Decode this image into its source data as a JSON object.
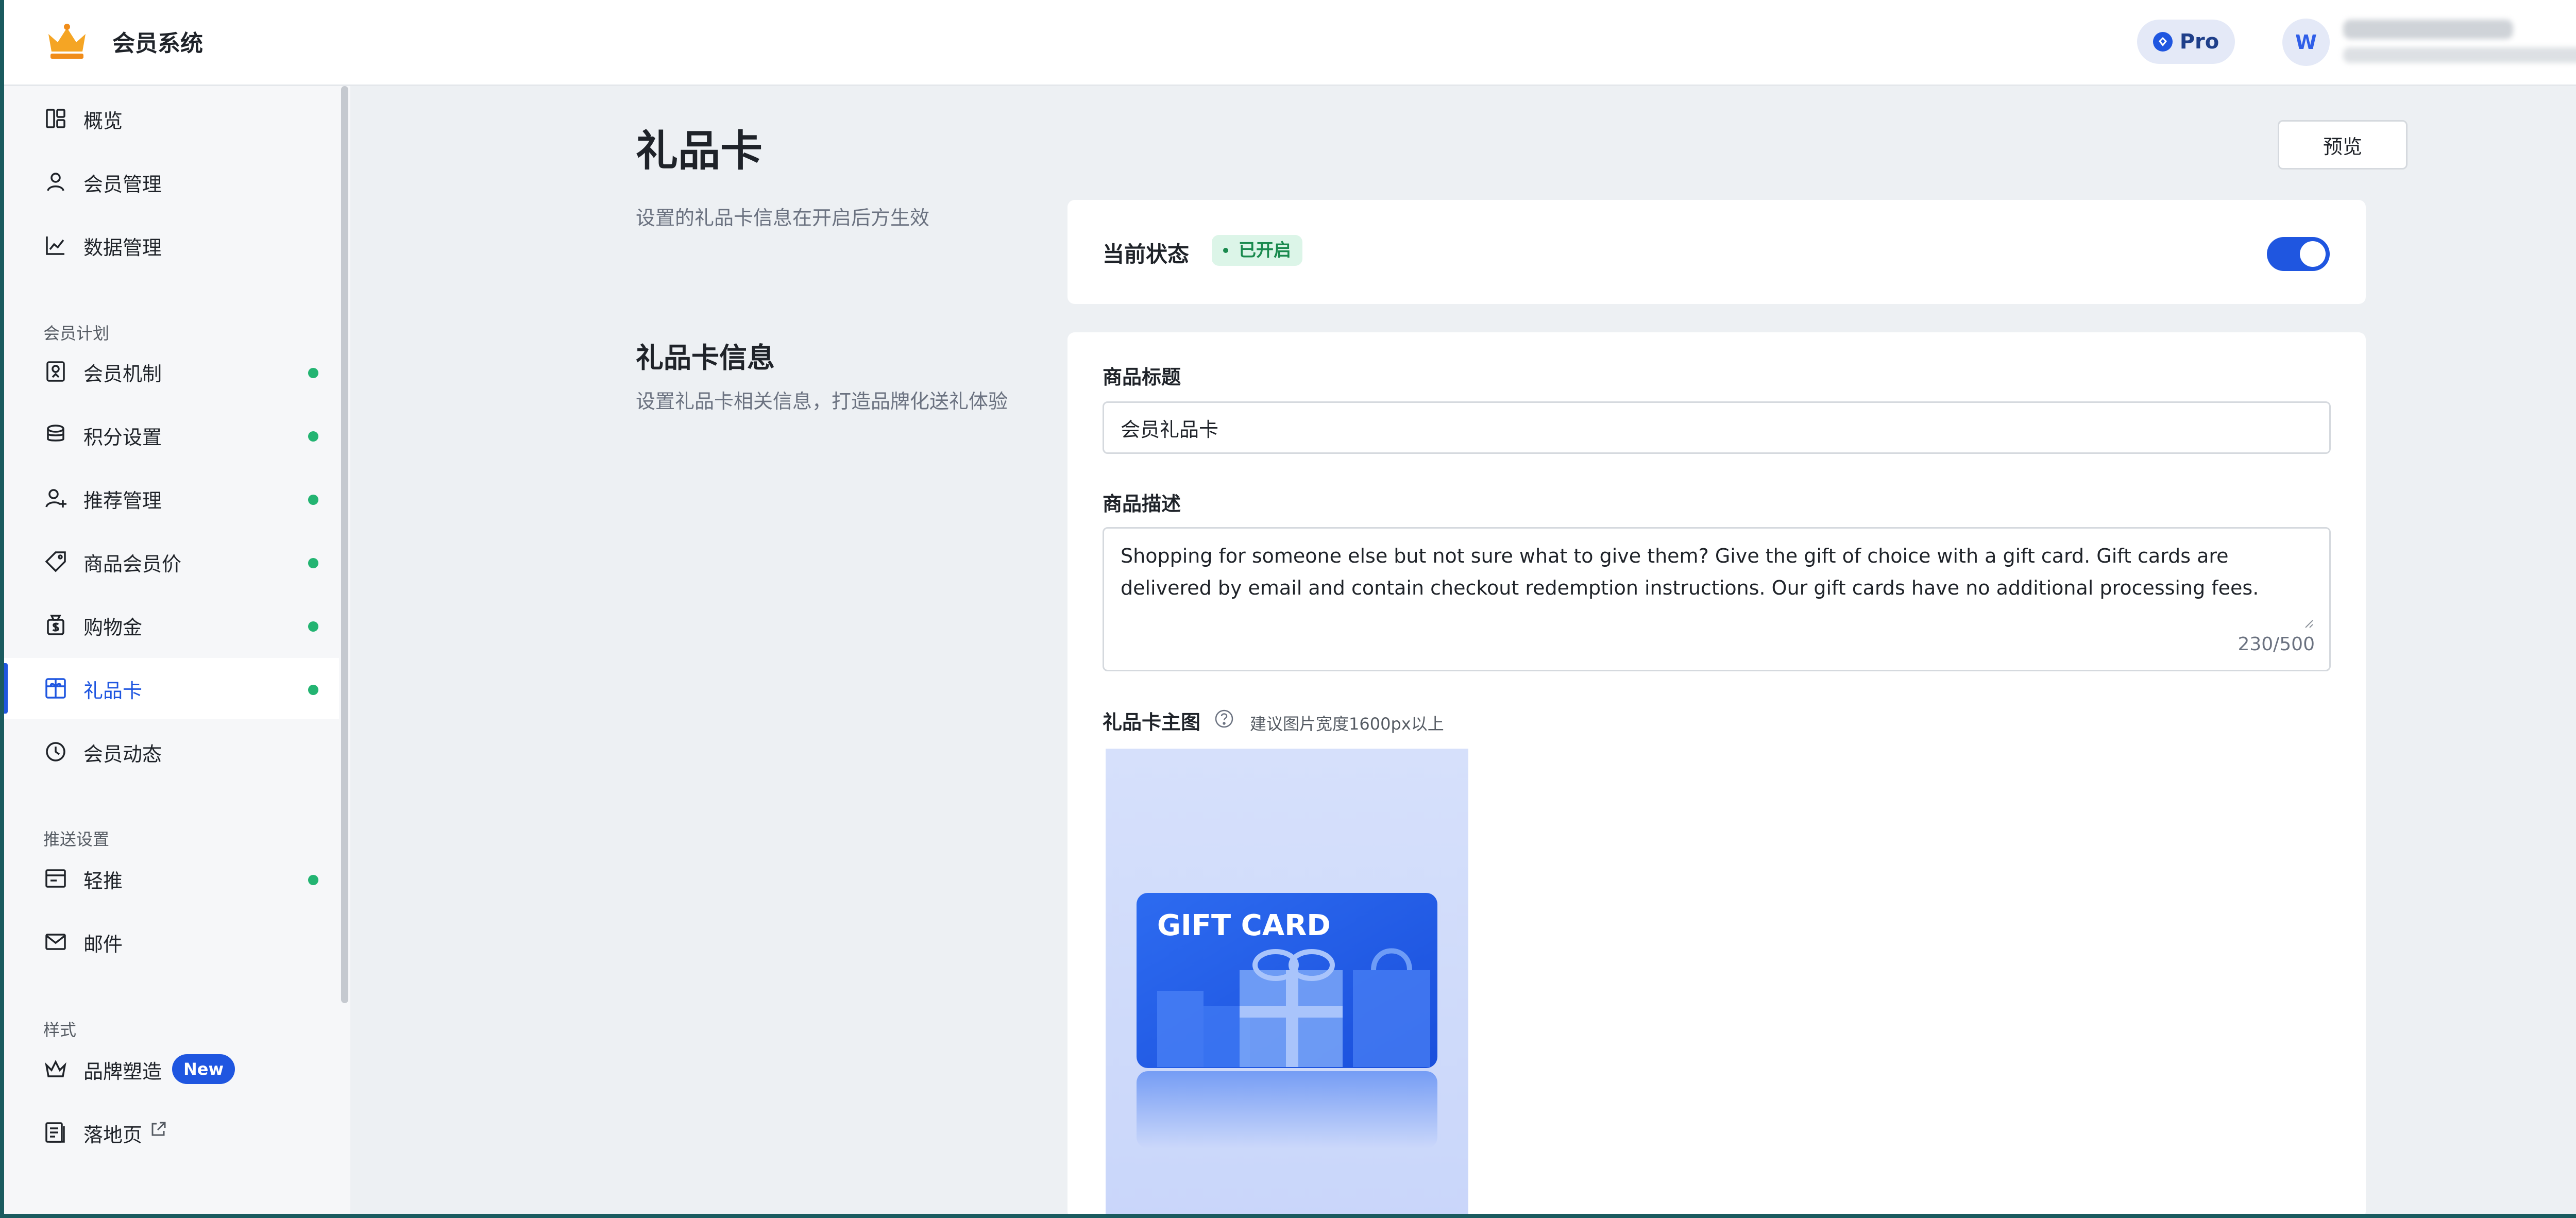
{
  "app": {
    "title": "会员系统",
    "plan": "Pro",
    "avatar_initial": "W"
  },
  "sidebar": {
    "items": [
      {
        "label": "概览",
        "icon": "overview-icon"
      },
      {
        "label": "会员管理",
        "icon": "user-icon"
      },
      {
        "label": "数据管理",
        "icon": "chart-icon"
      },
      {
        "label": "会员机制",
        "icon": "badge-icon",
        "dot": true
      },
      {
        "label": "积分设置",
        "icon": "coins-stack-icon",
        "dot": true
      },
      {
        "label": "推荐管理",
        "icon": "user-add-icon",
        "dot": true
      },
      {
        "label": "商品会员价",
        "icon": "price-tag-icon",
        "dot": true
      },
      {
        "label": "购物金",
        "icon": "money-bag-icon",
        "dot": true
      },
      {
        "label": "礼品卡",
        "icon": "gift-card-icon",
        "dot": true,
        "active": true
      },
      {
        "label": "会员动态",
        "icon": "clock-icon"
      },
      {
        "label": "轻推",
        "icon": "nudge-icon",
        "dot": true
      },
      {
        "label": "邮件",
        "icon": "mail-icon"
      },
      {
        "label": "品牌塑造",
        "icon": "crown-icon",
        "badge": "New"
      },
      {
        "label": "落地页",
        "icon": "page-icon",
        "external": true
      }
    ],
    "sections": [
      "会员计划",
      "推送设置",
      "样式"
    ]
  },
  "page": {
    "title": "礼品卡",
    "subtitle": "设置的礼品卡信息在开启后方生效",
    "preview_label": "预览"
  },
  "status": {
    "label": "当前状态",
    "badge": "已开启",
    "enabled": true
  },
  "info": {
    "title": "礼品卡信息",
    "subtitle": "设置礼品卡相关信息，打造品牌化送礼体验",
    "product_title_label": "商品标题",
    "product_title_value": "会员礼品卡",
    "product_desc_label": "商品描述",
    "product_desc_value": "Shopping for someone else but not sure what to give them? Give the gift of choice with a gift card. Gift cards are delivered by email and contain checkout redemption instructions. Our gift cards have no additional processing fees.",
    "char_count": "230/500",
    "image_label": "礼品卡主图",
    "image_hint": "建议图片宽度1600px以上",
    "card_text": "GIFT CARD"
  },
  "colors": {
    "accent": "#1f56e0",
    "success": "#23b472",
    "page_bg": "#edf0f3"
  }
}
